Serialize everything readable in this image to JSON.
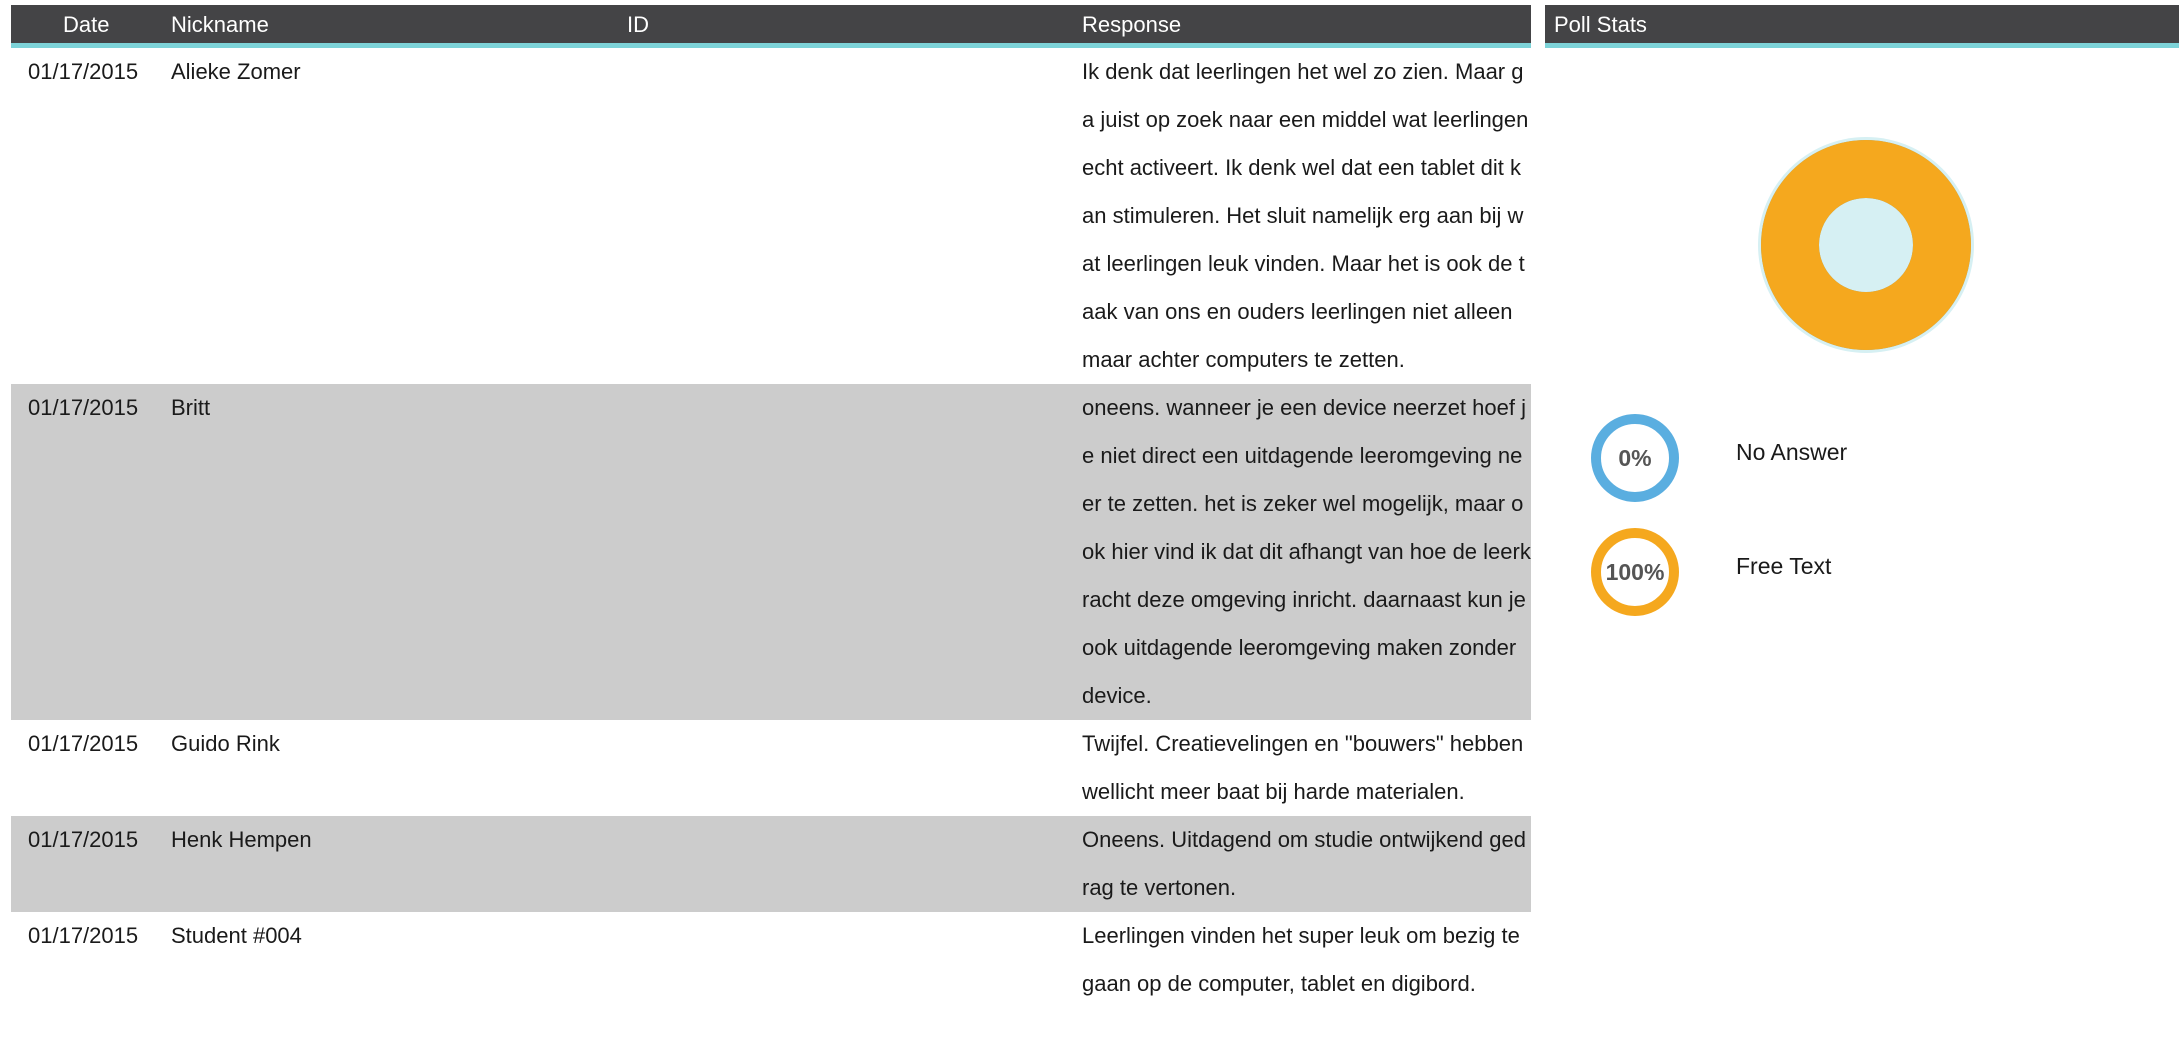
{
  "table": {
    "headers": {
      "date": "Date",
      "nickname": "Nickname",
      "id": "ID",
      "response": "Response"
    },
    "rows": [
      {
        "date": "01/17/2015",
        "nickname": "Alieke Zomer",
        "id": "",
        "response": "Ik denk dat leerlingen het wel zo zien. Maar ga juist op zoek naar een middel wat leerlingen echt activeert. Ik denk wel dat een tablet dit kan stimuleren. Het sluit namelijk erg aan bij wat leerlingen leuk vinden. Maar het is ook de taak van ons en ouders leerlingen niet alleen maar achter computers te zetten."
      },
      {
        "date": "01/17/2015",
        "nickname": "Britt",
        "id": "",
        "response": "oneens. wanneer je een device neerzet hoef je niet direct een uitdagende leeromgeving neer te zetten. het is zeker wel mogelijk, maar ook hier vind ik dat dit afhangt van hoe de leerkracht deze omgeving inricht. daarnaast kun je ook uitdagende leeromgeving maken zonder device."
      },
      {
        "date": "01/17/2015",
        "nickname": "Guido Rink",
        "id": "",
        "response": "Twijfel. Creatievelingen en \"bouwers\" hebben wellicht meer baat bij harde materialen."
      },
      {
        "date": "01/17/2015",
        "nickname": "Henk Hempen",
        "id": "",
        "response": "Oneens. Uitdagend om studie ontwijkend gedrag te vertonen."
      },
      {
        "date": "01/17/2015",
        "nickname": "Student #004",
        "id": "",
        "response": "Leerlingen vinden het super leuk om bezig te gaan op de computer, tablet en digibord."
      }
    ]
  },
  "stats": {
    "title": "Poll Stats",
    "items": [
      {
        "label": "No Answer",
        "percent_text": "0%",
        "fraction": 0.0,
        "color": "#5aaee0"
      },
      {
        "label": "Free Text",
        "percent_text": "100%",
        "fraction": 1.0,
        "color": "#f5a81e"
      }
    ],
    "donut_ring_color": "#d6f0f3"
  }
}
